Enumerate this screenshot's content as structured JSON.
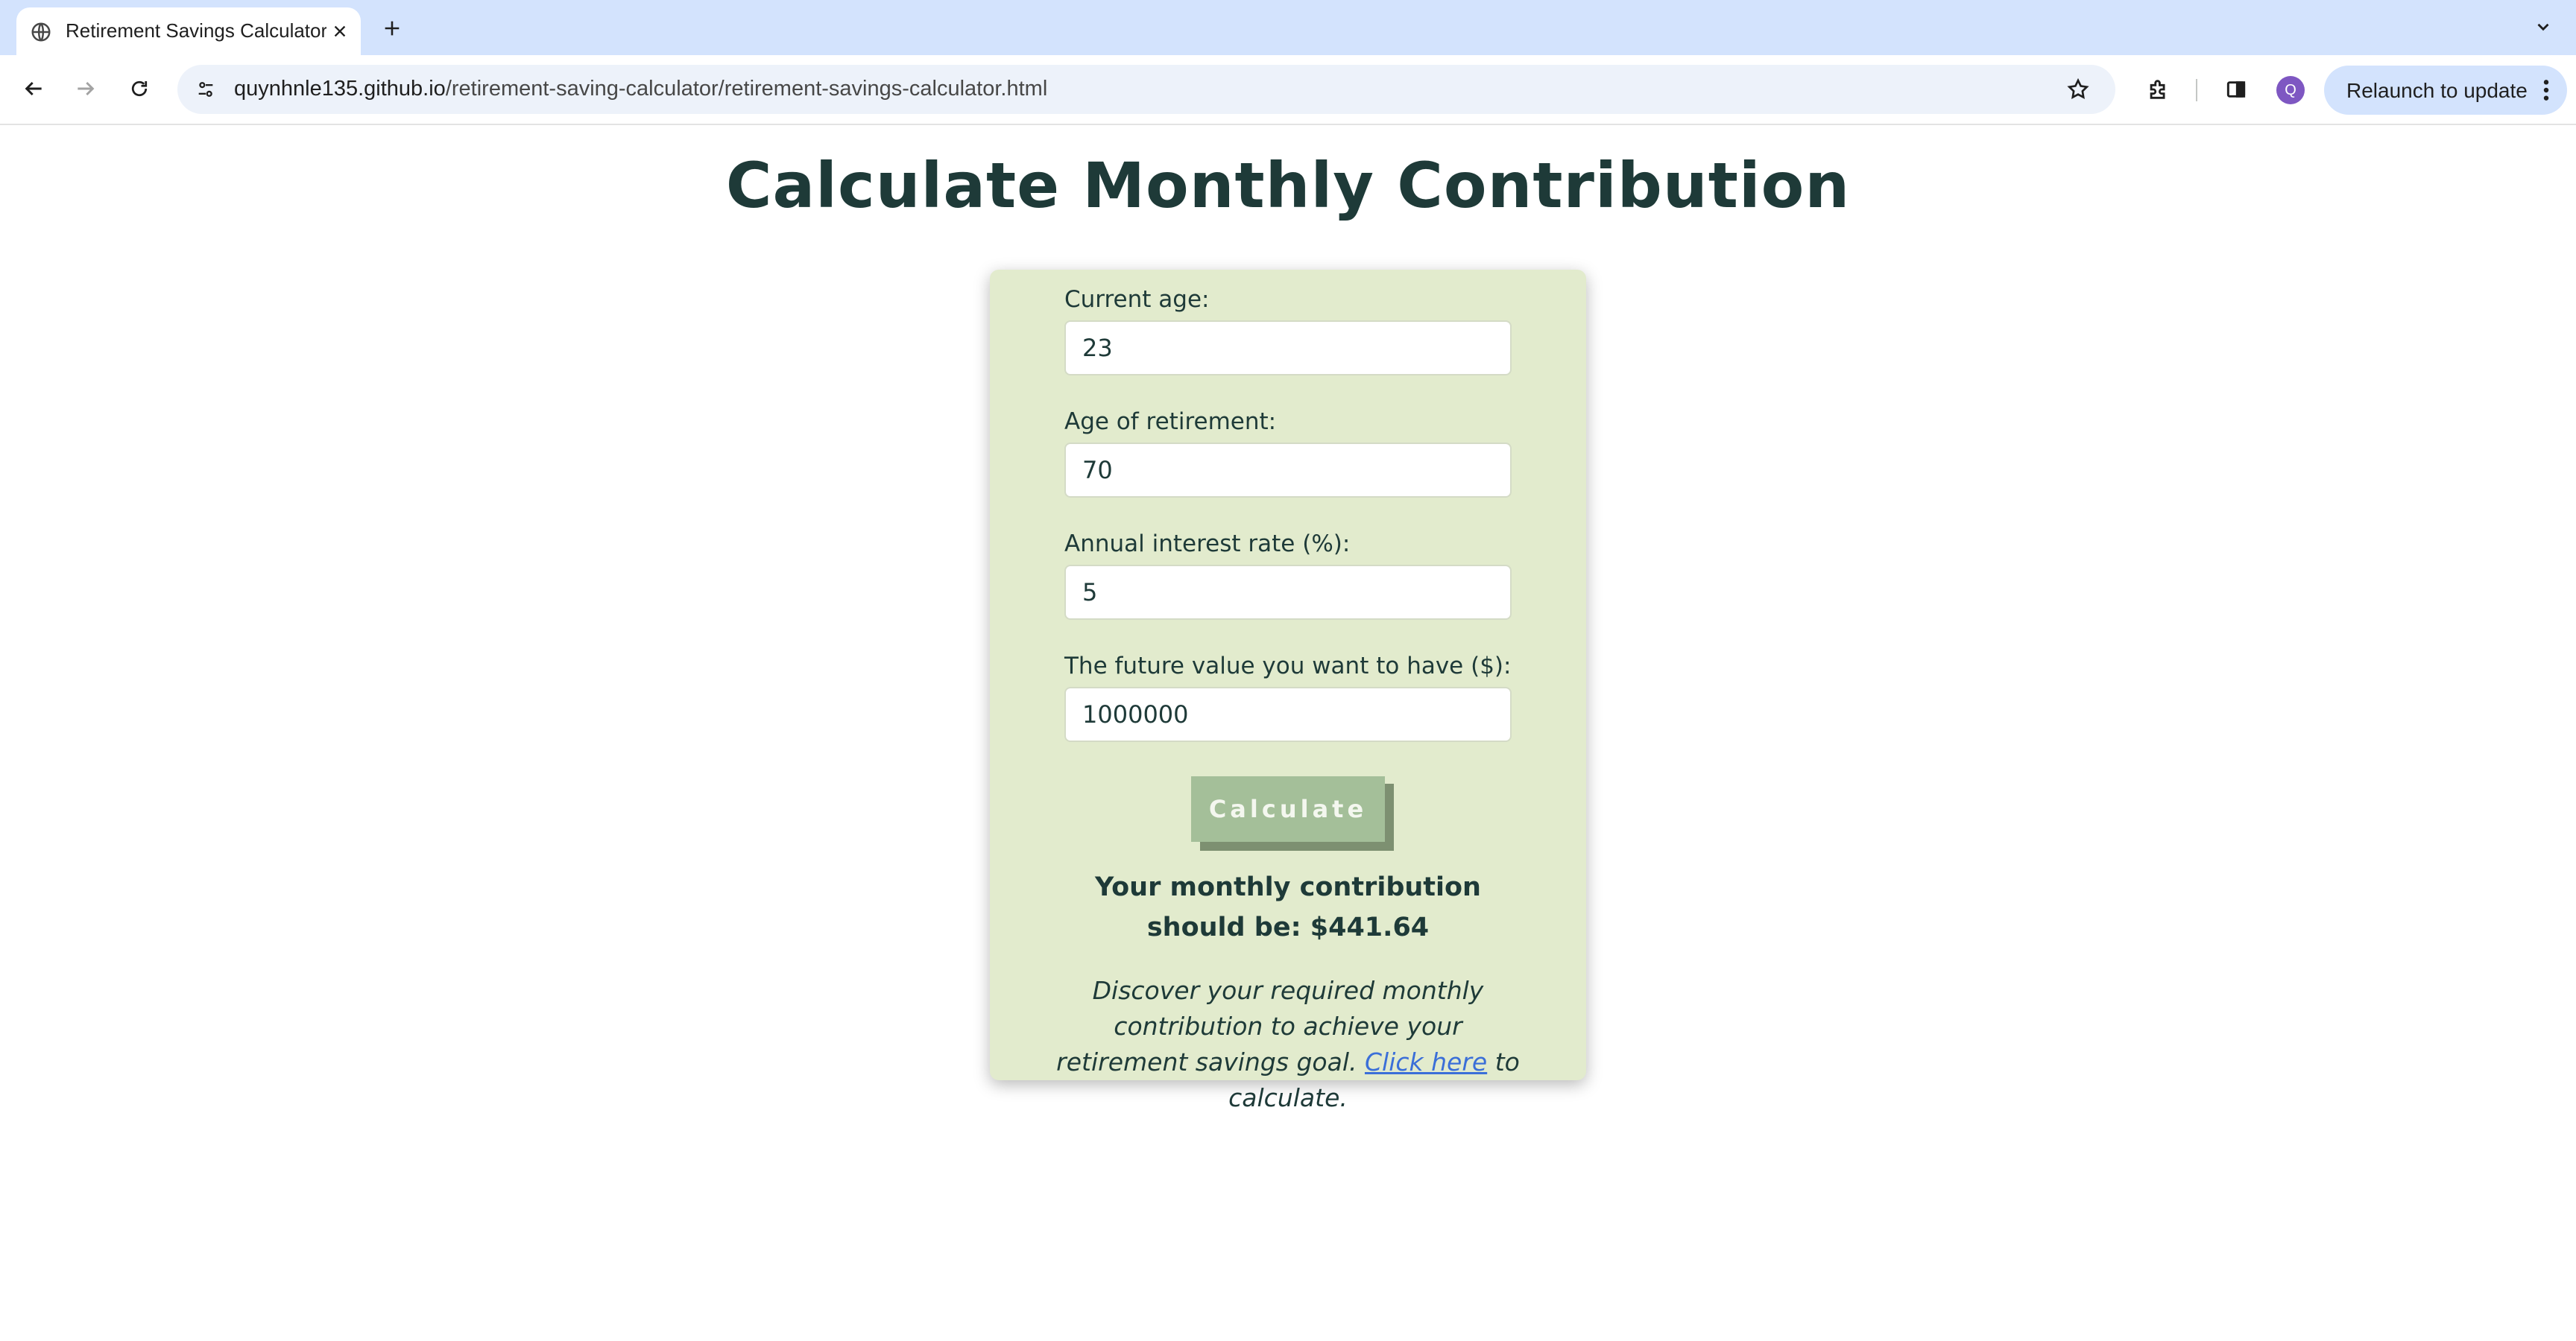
{
  "browser": {
    "tab_title": "Retirement Savings Calculator",
    "url_host": "quynhnle135.github.io",
    "url_path": "/retirement-saving-calculator/retirement-savings-calculator.html",
    "profile_initial": "Q",
    "relaunch_label": "Relaunch to update",
    "icons": {
      "favicon": "globe-icon",
      "close": "close-icon",
      "new_tab": "plus-icon",
      "tab_list": "chevron-down-icon",
      "back": "back-arrow-icon",
      "forward": "forward-arrow-icon",
      "reload": "reload-icon",
      "site_info": "tune-icon",
      "bookmark": "star-icon",
      "extensions": "puzzle-icon",
      "side_panel": "side-panel-icon",
      "menu": "kebab-menu-icon"
    },
    "colors": {
      "tabbar": "#d3e3fd",
      "omnibox": "#edf2fa",
      "relaunch": "#d3e3fd",
      "profile": "#7e57c2"
    }
  },
  "page": {
    "title": "Calculate Monthly Contribution",
    "fields": [
      {
        "label": "Current age:",
        "value": "23"
      },
      {
        "label": "Age of retirement:",
        "value": "70"
      },
      {
        "label": "Annual interest rate (%):",
        "value": "5"
      },
      {
        "label": "The future value you want to have ($):",
        "value": "1000000"
      }
    ],
    "calculate_label": "Calculate",
    "result_text": "Your monthly contribution should be: $441.64",
    "note_prefix": "Discover your required monthly contribution to achieve your retirement savings goal. ",
    "note_link": "Click here",
    "note_suffix": " to calculate.",
    "colors": {
      "title": "#1e3a38",
      "card": "#e2ebcd",
      "button": "#a4bf99",
      "button_shadow": "#7d9071",
      "link": "#3b6fd8"
    }
  }
}
